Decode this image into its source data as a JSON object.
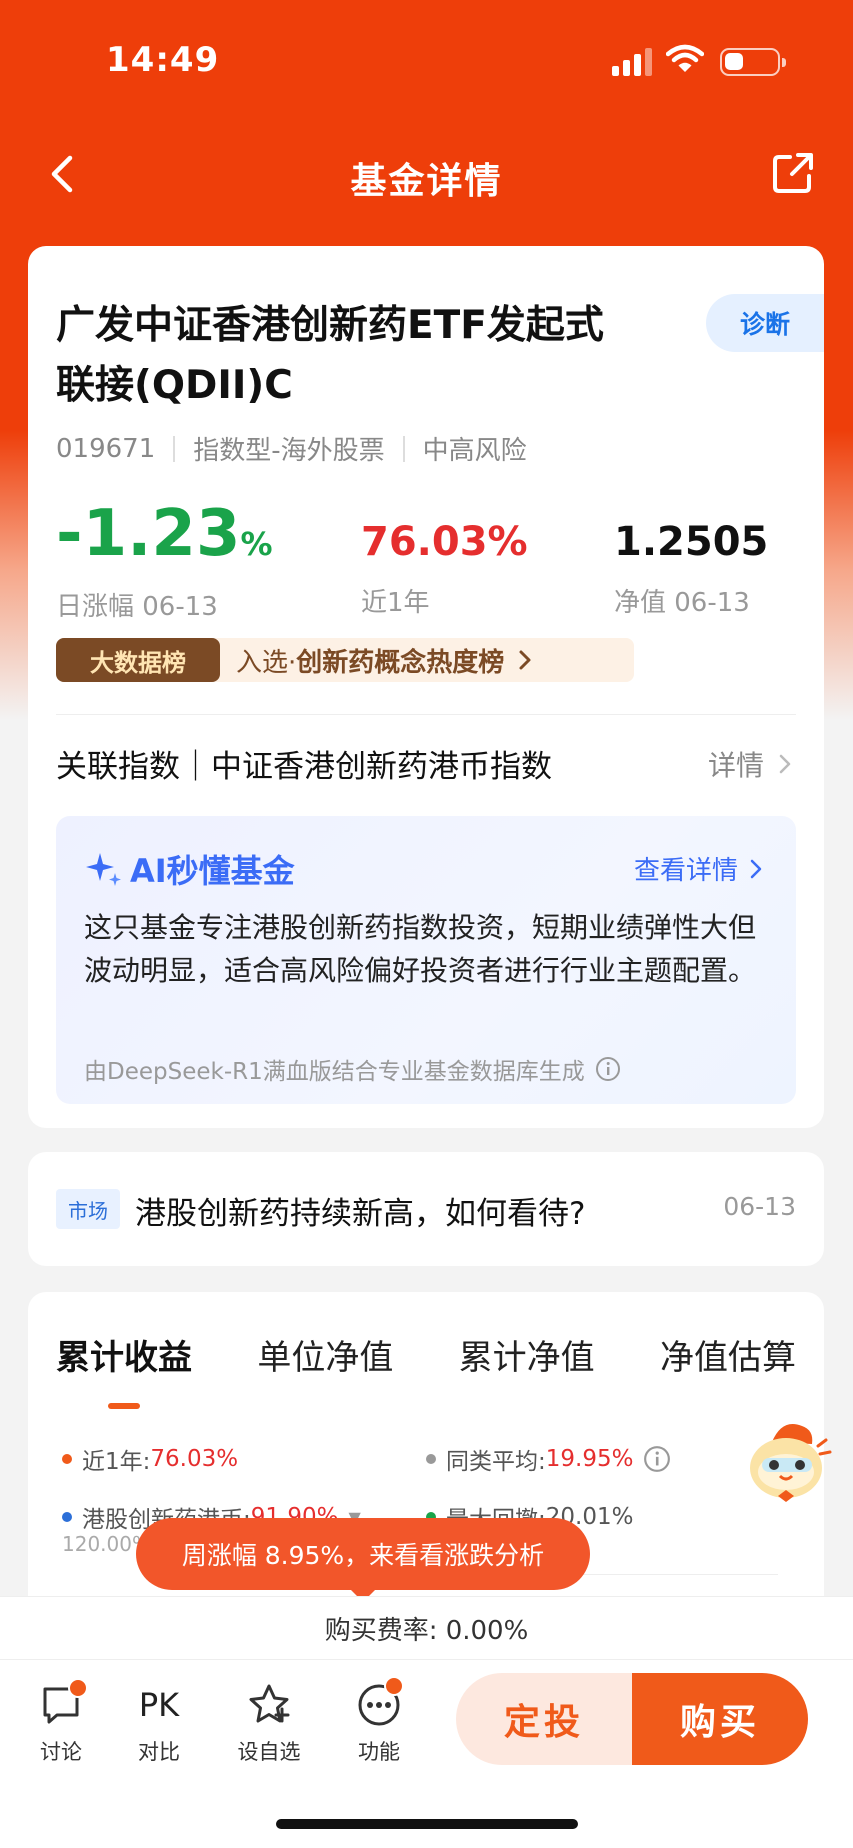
{
  "status_bar": {
    "time": "14:49"
  },
  "nav": {
    "title": "基金详情"
  },
  "fund": {
    "name": "广发中证香港创新药ETF发起式联接(QDII)C",
    "code": "019671",
    "category": "指数型-海外股票",
    "risk": "中高风险",
    "diagnose_label": "诊断"
  },
  "metrics": {
    "daily_change": {
      "value": "-1.23",
      "unit": "%",
      "label": "日涨幅 06-13"
    },
    "one_year": {
      "value": "76.03%",
      "label": "近1年"
    },
    "nav": {
      "value": "1.2505",
      "label": "净值 06-13"
    }
  },
  "rank_banner": {
    "tag": "大数据榜",
    "prefix": "入选·",
    "name": "创新药概念热度榜"
  },
  "related_index": {
    "title": "关联指数｜中证香港创新药港币指数",
    "link": "详情"
  },
  "ai": {
    "title": "AI秒懂基金",
    "link": "查看详情",
    "body": "这只基金专注港股创新药指数投资，短期业绩弹性大但波动明显，适合高风险偏好投资者进行行业主题配置。",
    "footer": "由DeepSeek-R1满血版结合专业基金数据库生成"
  },
  "news": {
    "tag": "市场",
    "title": "港股创新药持续新高，如何看待?",
    "date": "06-13"
  },
  "chart_tabs": [
    "累计收益",
    "单位净值",
    "累计净值",
    "净值估算"
  ],
  "legend": [
    {
      "label": "近1年:",
      "value": "76.03%",
      "color": "#f05a1a"
    },
    {
      "label": "同类平均:",
      "value": "19.95%",
      "color": "#999999"
    },
    {
      "label": "港股创新药港币:",
      "value": "91.90%",
      "color": "#2c6fd8"
    },
    {
      "label": "最大回撤:",
      "value": "20.01%",
      "color": "#1aa34a"
    }
  ],
  "axis_top_label": "120.00%",
  "tooltip": "周涨幅 8.95%，来看看涨跌分析",
  "fee": "购买费率: 0.00%",
  "bottom_nav": {
    "discuss": "讨论",
    "pk_icon_text": "PK",
    "compare": "对比",
    "watchlist": "设自选",
    "functions": "功能",
    "dingtou": "定投",
    "buy": "购买"
  },
  "colors": {
    "brand": "#ee3e0a",
    "up": "#e52e2e",
    "down": "#1aa34a",
    "ai": "#3b6cf6"
  }
}
